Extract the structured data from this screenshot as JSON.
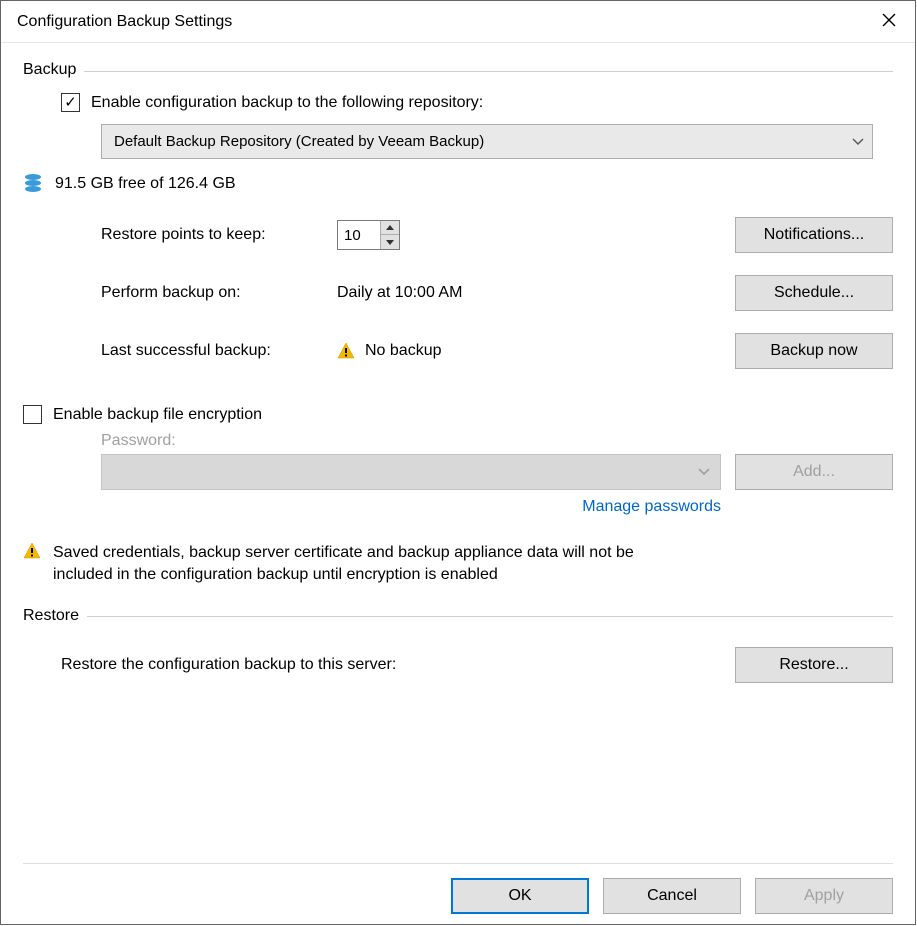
{
  "window": {
    "title": "Configuration Backup Settings"
  },
  "groups": {
    "backup": "Backup",
    "restore": "Restore"
  },
  "backup": {
    "enable_label": "Enable configuration backup to the following repository:",
    "repository": "Default Backup Repository (Created by Veeam Backup)",
    "storage": "91.5 GB free of 126.4 GB",
    "restore_points_label": "Restore points to keep:",
    "restore_points_value": "10",
    "perform_label": "Perform backup on:",
    "perform_value": "Daily at 10:00 AM",
    "last_label": "Last successful backup:",
    "last_value": "No backup",
    "notifications_btn": "Notifications...",
    "schedule_btn": "Schedule...",
    "backup_now_btn": "Backup now"
  },
  "encryption": {
    "enable_label": "Enable backup file encryption",
    "password_label": "Password:",
    "add_btn": "Add...",
    "manage_link": "Manage passwords",
    "warning": "Saved credentials, backup server certificate and backup appliance data will not be included in the configuration backup until encryption is enabled"
  },
  "restore": {
    "label": "Restore the configuration backup to this server:",
    "btn": "Restore..."
  },
  "footer": {
    "ok": "OK",
    "cancel": "Cancel",
    "apply": "Apply"
  }
}
